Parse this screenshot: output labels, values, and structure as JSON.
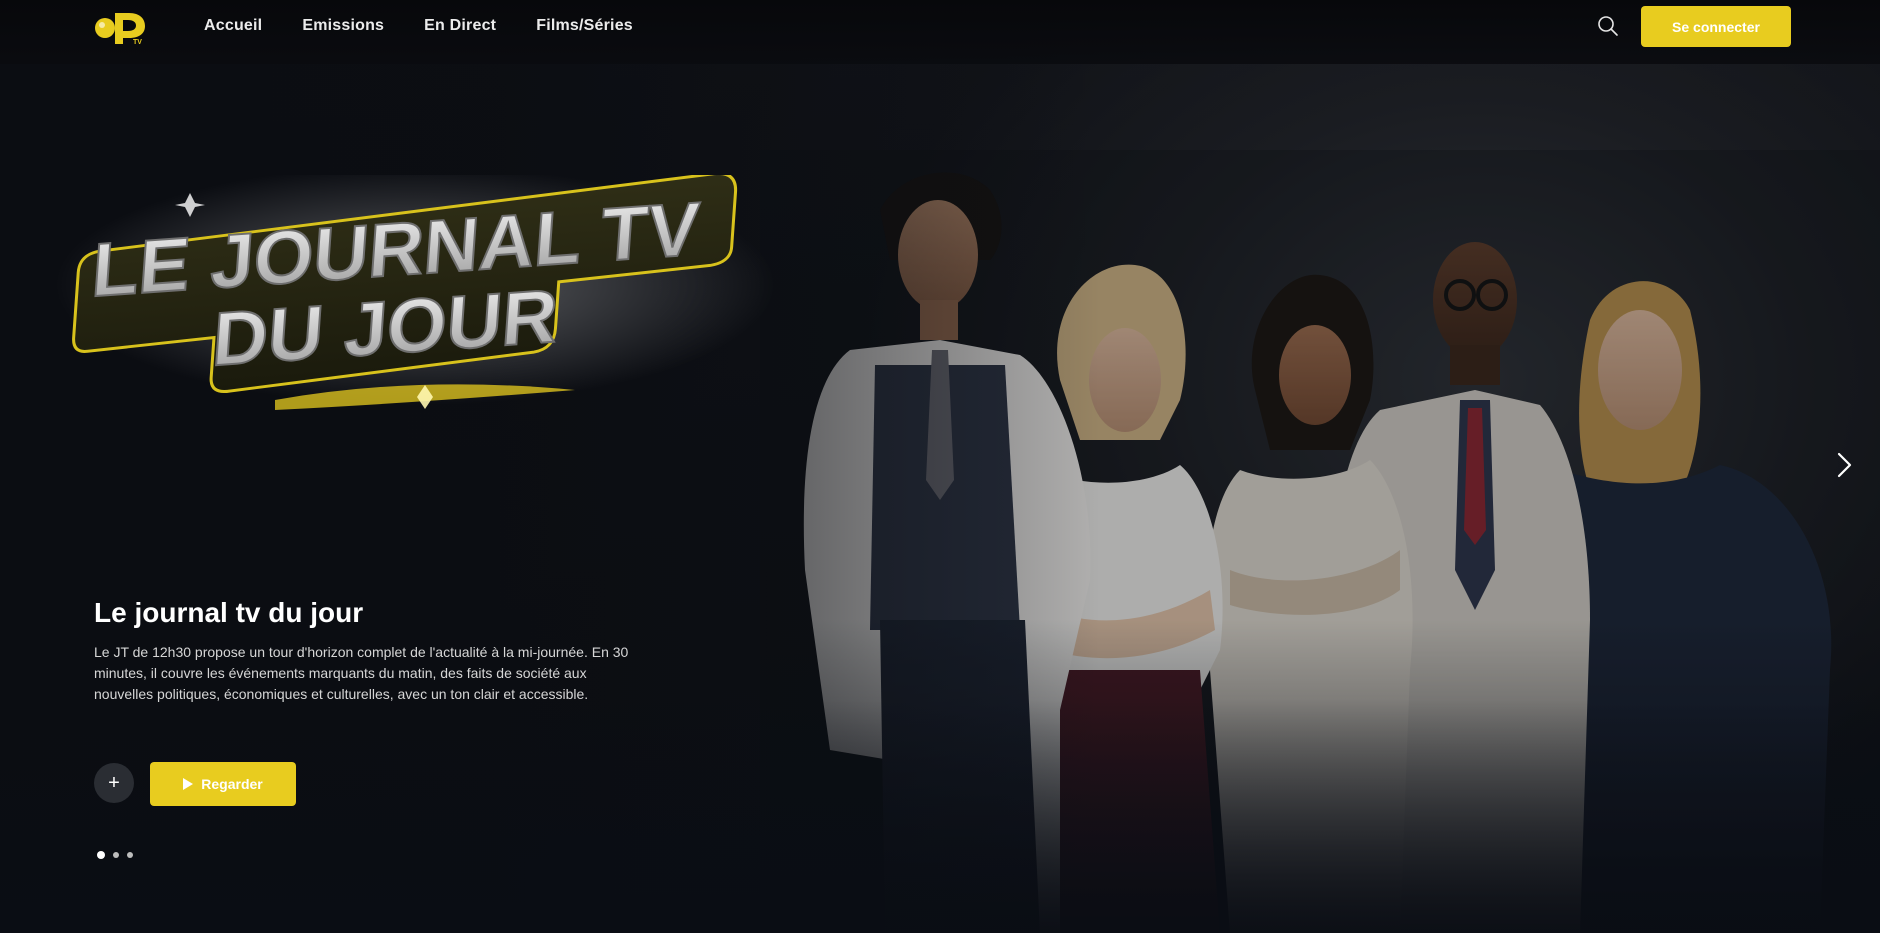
{
  "header": {
    "logo_text": "OP TV",
    "nav": [
      "Accueil",
      "Emissions",
      "En Direct",
      "Films/Séries"
    ],
    "login_label": "Se connecter",
    "accent_color": "#e8cc1f"
  },
  "hero": {
    "title_art_lines": [
      "LE JOURNAL TV",
      "DU JOUR"
    ],
    "title": "Le journal tv du jour",
    "description": "Le JT de 12h30 propose un tour d'horizon complet de l'actualité à la mi-journée. En 30 minutes, il couvre les événements marquants du matin, des faits de société aux nouvelles politiques, économiques et culturelles, avec un ton clair et accessible.",
    "add_label": "+",
    "watch_label": "Regarder",
    "slides": 3,
    "active_slide": 1
  },
  "icons": [
    "search-icon",
    "play-icon",
    "chevron-right-icon",
    "plus-icon"
  ]
}
